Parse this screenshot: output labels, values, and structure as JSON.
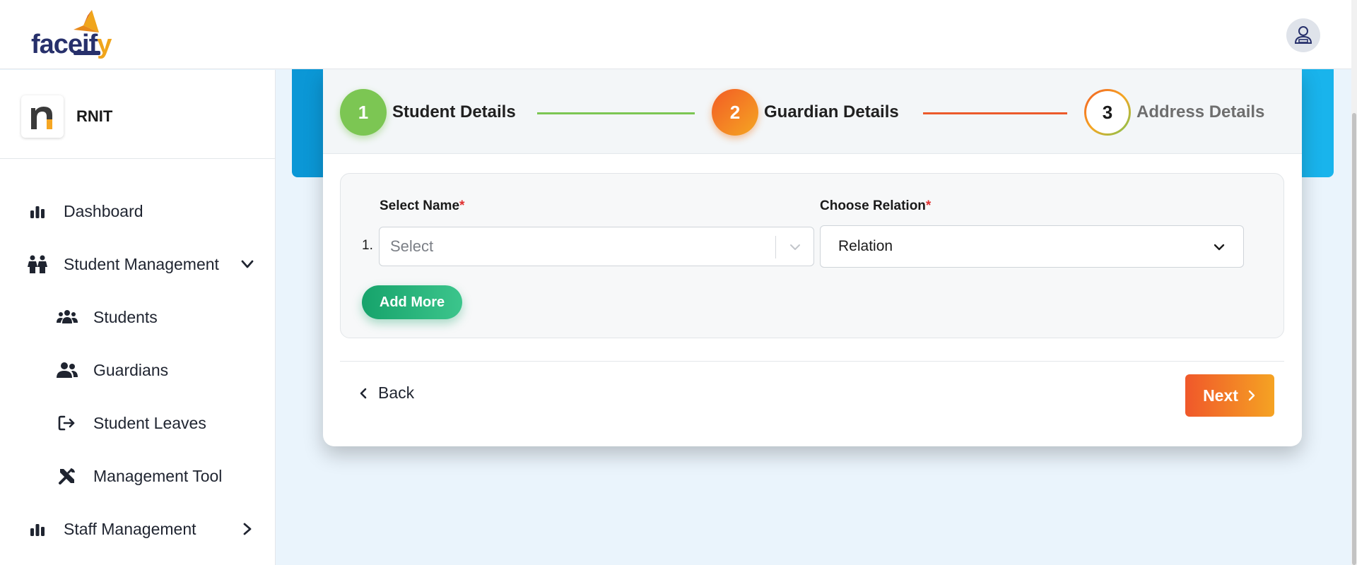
{
  "header": {
    "logo_text_main": "faceif",
    "logo_text_y": "y",
    "profile_icon": "user-avatar-icon"
  },
  "sidebar": {
    "org_name": "RNIT",
    "items": [
      {
        "label": "Dashboard",
        "icon": "bar-chart-icon"
      },
      {
        "label": "Student Management",
        "icon": "students-pair-icon",
        "expanded": true
      },
      {
        "label": "Students",
        "icon": "users-group-icon"
      },
      {
        "label": "Guardians",
        "icon": "users-icon"
      },
      {
        "label": "Student Leaves",
        "icon": "sign-out-icon"
      },
      {
        "label": "Management Tool",
        "icon": "tools-icon"
      },
      {
        "label": "Staff Management",
        "icon": "bar-chart-icon",
        "expanded": false
      }
    ]
  },
  "stepper": {
    "steps": [
      {
        "number": "1",
        "label": "Student Details",
        "status": "completed",
        "color": "#7cc653"
      },
      {
        "number": "2",
        "label": "Guardian Details",
        "status": "active",
        "color": "#f17a22"
      },
      {
        "number": "3",
        "label": "Address Details",
        "status": "pending",
        "color": "#ffffff"
      }
    ],
    "line_colors": [
      "#7cc653",
      "#ec5a2b"
    ]
  },
  "form": {
    "select_name_label": "Select Name",
    "choose_relation_label": "Choose Relation",
    "required_mark": "*",
    "rows": [
      {
        "number": "1.",
        "name_placeholder": "Select",
        "relation_value": "Relation"
      }
    ],
    "add_more_label": "Add More"
  },
  "footer": {
    "back_label": "Back",
    "next_label": "Next"
  }
}
